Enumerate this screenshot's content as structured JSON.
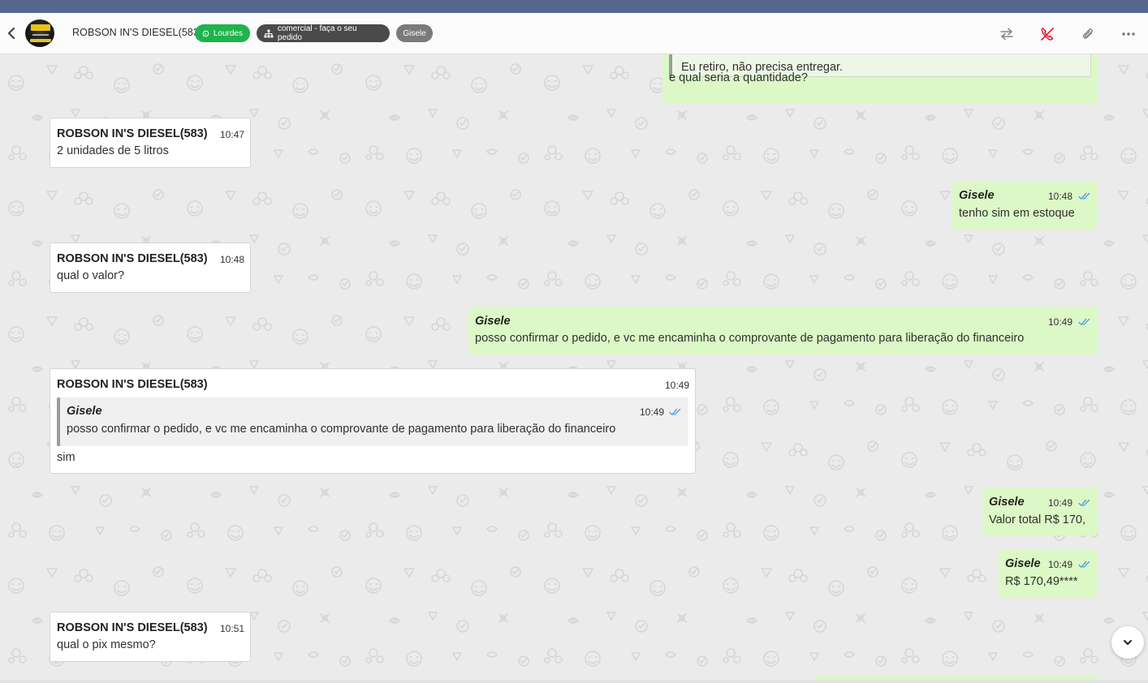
{
  "header": {
    "contact_name": "ROBSON IN'S DIESEL(583)",
    "badges": {
      "whatsapp_user": "Lourdes",
      "department": "comercial - faça o seu pedido",
      "agent": "Gisele"
    },
    "icons": [
      "back-icon",
      "avatar",
      "whatsapp-icon",
      "sitemap-icon",
      "transfer-icon",
      "hangup-icon",
      "attach-icon",
      "more-icon"
    ]
  },
  "messages": [
    {
      "id": "m0",
      "dir": "out",
      "quoted_text": "Eu retiro, não precisa entregar.",
      "text": "e qual seria a quantidade?"
    },
    {
      "id": "m1",
      "dir": "in",
      "sender": "ROBSON IN'S DIESEL(583)",
      "time": "10:47",
      "text": "2 unidades de 5 litros"
    },
    {
      "id": "m2",
      "dir": "out",
      "sender": "Gisele",
      "time": "10:48",
      "text": "tenho sim em estoque"
    },
    {
      "id": "m3",
      "dir": "in",
      "sender": "ROBSON IN'S DIESEL(583)",
      "time": "10:48",
      "text": "qual o valor?"
    },
    {
      "id": "m4",
      "dir": "out",
      "sender": "Gisele",
      "time": "10:49",
      "text": "posso confirmar o pedido, e vc me encaminha o comprovante de pagamento para liberação do financeiro"
    },
    {
      "id": "m5",
      "dir": "in",
      "sender": "ROBSON IN'S DIESEL(583)",
      "time": "10:49",
      "quote": {
        "sender": "Gisele",
        "time": "10:49",
        "text": "posso confirmar o pedido, e vc me encaminha o comprovante de pagamento para liberação do financeiro"
      },
      "text": "sim"
    },
    {
      "id": "m6",
      "dir": "out",
      "sender": "Gisele",
      "time": "10:49",
      "text": "Valor total R$ 170,"
    },
    {
      "id": "m7",
      "dir": "out",
      "sender": "Gisele",
      "time": "10:49",
      "text": "R$ 170,49****"
    },
    {
      "id": "m8",
      "dir": "in",
      "sender": "ROBSON IN'S DIESEL(583)",
      "time": "10:51",
      "text": "qual o pix mesmo?"
    }
  ],
  "colors": {
    "top_bar": "#56678f",
    "incoming_bubble": "#ffffff",
    "outgoing_bubble": "#dcf8c6",
    "read_ticks": "#4fa3e6",
    "hangup_icon": "#e0283a",
    "badge_whatsapp": "#1eb34c",
    "badge_department": "#4a4a4a",
    "badge_agent": "#7a7a7a"
  }
}
